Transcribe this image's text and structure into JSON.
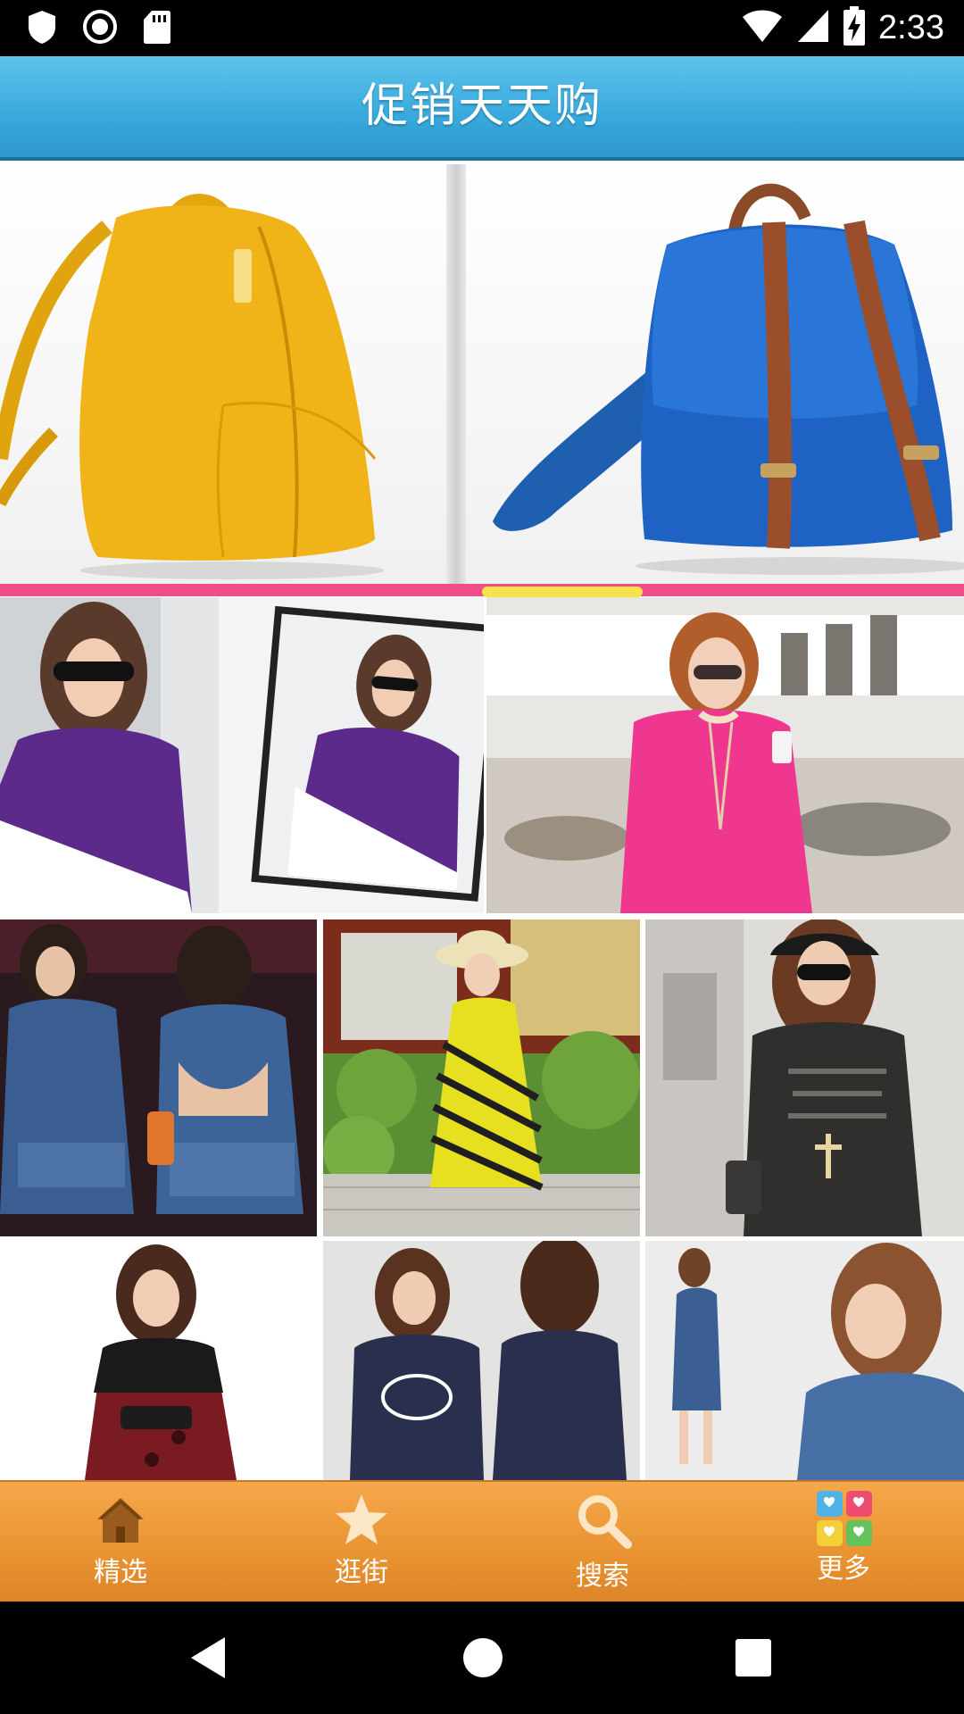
{
  "status_bar": {
    "time": "2:33",
    "icons": [
      "shield-icon",
      "circle-record-icon",
      "sd-card-icon",
      "wifi-icon",
      "cell-signal-icon",
      "battery-charging-icon"
    ]
  },
  "app_bar": {
    "title": "促销天天购"
  },
  "banner": {
    "slides": [
      "yellow-backpack",
      "blue-backpack"
    ],
    "active_indicator_index": 1
  },
  "product_grid": {
    "items": [
      "purple-white-top",
      "pink-tunic",
      "denim-jumpsuit",
      "yellow-striped-dress",
      "black-tshirt-cap",
      "red-lace-dress",
      "navy-graphic-tshirt",
      "denim-dress"
    ]
  },
  "bottom_nav": {
    "items": [
      {
        "label": "精选",
        "icon": "home-icon"
      },
      {
        "label": "逛街",
        "icon": "star-icon"
      },
      {
        "label": "搜索",
        "icon": "search-icon"
      },
      {
        "label": "更多",
        "icon": "more-grid-icon"
      }
    ]
  },
  "system_nav": {
    "buttons": [
      "back-icon",
      "home-circle-icon",
      "recents-icon"
    ]
  },
  "colors": {
    "app_bar": "#38a9dc",
    "banner_bar": "#ef4d88",
    "indicator": "#f5e34b",
    "bottom_nav": "#e99332"
  }
}
